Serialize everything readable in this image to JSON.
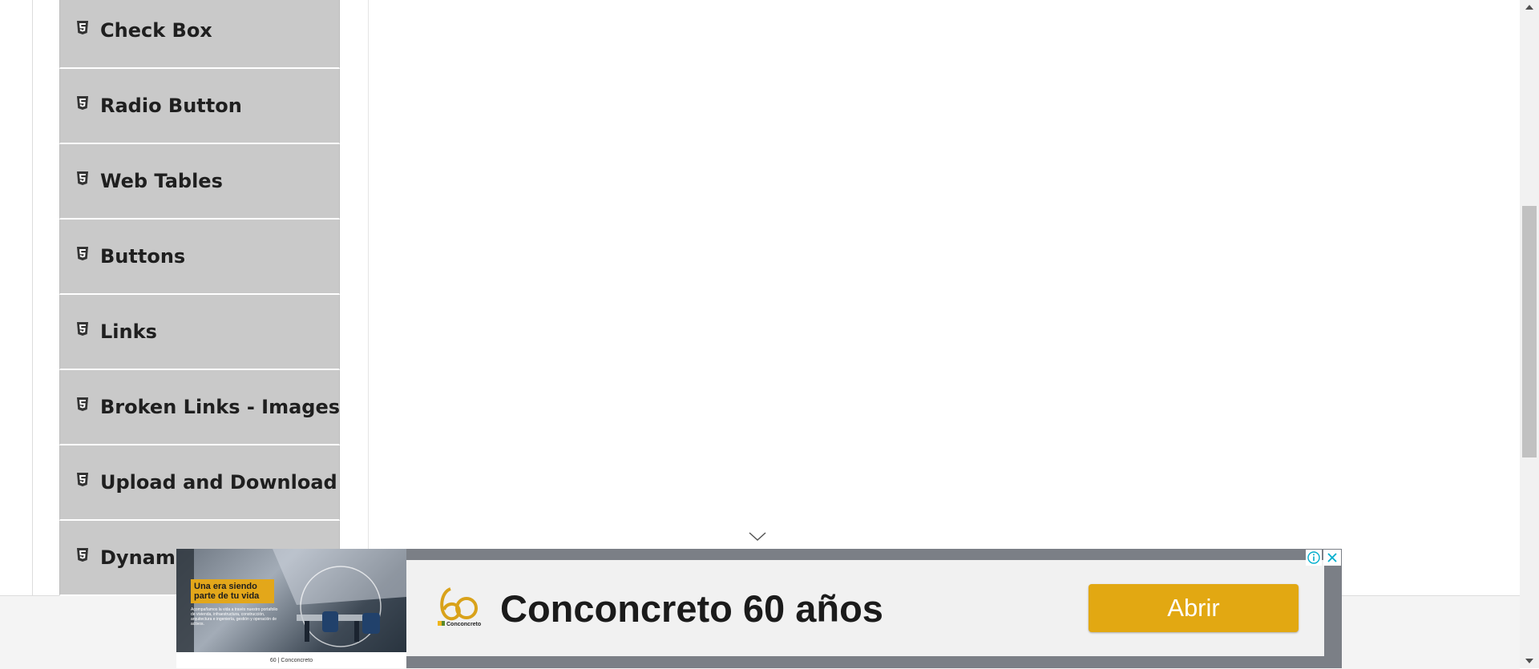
{
  "sidebar": {
    "items": [
      {
        "label": "Check Box",
        "icon": "html5-icon"
      },
      {
        "label": "Radio Button",
        "icon": "html5-icon"
      },
      {
        "label": "Web Tables",
        "icon": "html5-icon"
      },
      {
        "label": "Buttons",
        "icon": "html5-icon"
      },
      {
        "label": "Links",
        "icon": "html5-icon"
      },
      {
        "label": "Broken Links - Images",
        "icon": "html5-icon"
      },
      {
        "label": "Upload and Download",
        "icon": "html5-icon"
      },
      {
        "label": "Dynamic",
        "icon": "html5-icon"
      }
    ]
  },
  "ad": {
    "headline": "Conconcreto 60 años",
    "cta_label": "Abrir",
    "image_tagline": "Una era siendo parte de tu vida",
    "image_body": "Acompañamos la vida a través nuestro portafolio de vivienda, infraestructura, construcción, arquitectura e ingeniería, gestión y operación de activos.",
    "logo_brand": "Conconcreto",
    "image_logo_text": "60 | Conconcreto",
    "brand_color": "#e2a812",
    "info_icon": "info-icon",
    "close_icon": "close-icon"
  }
}
